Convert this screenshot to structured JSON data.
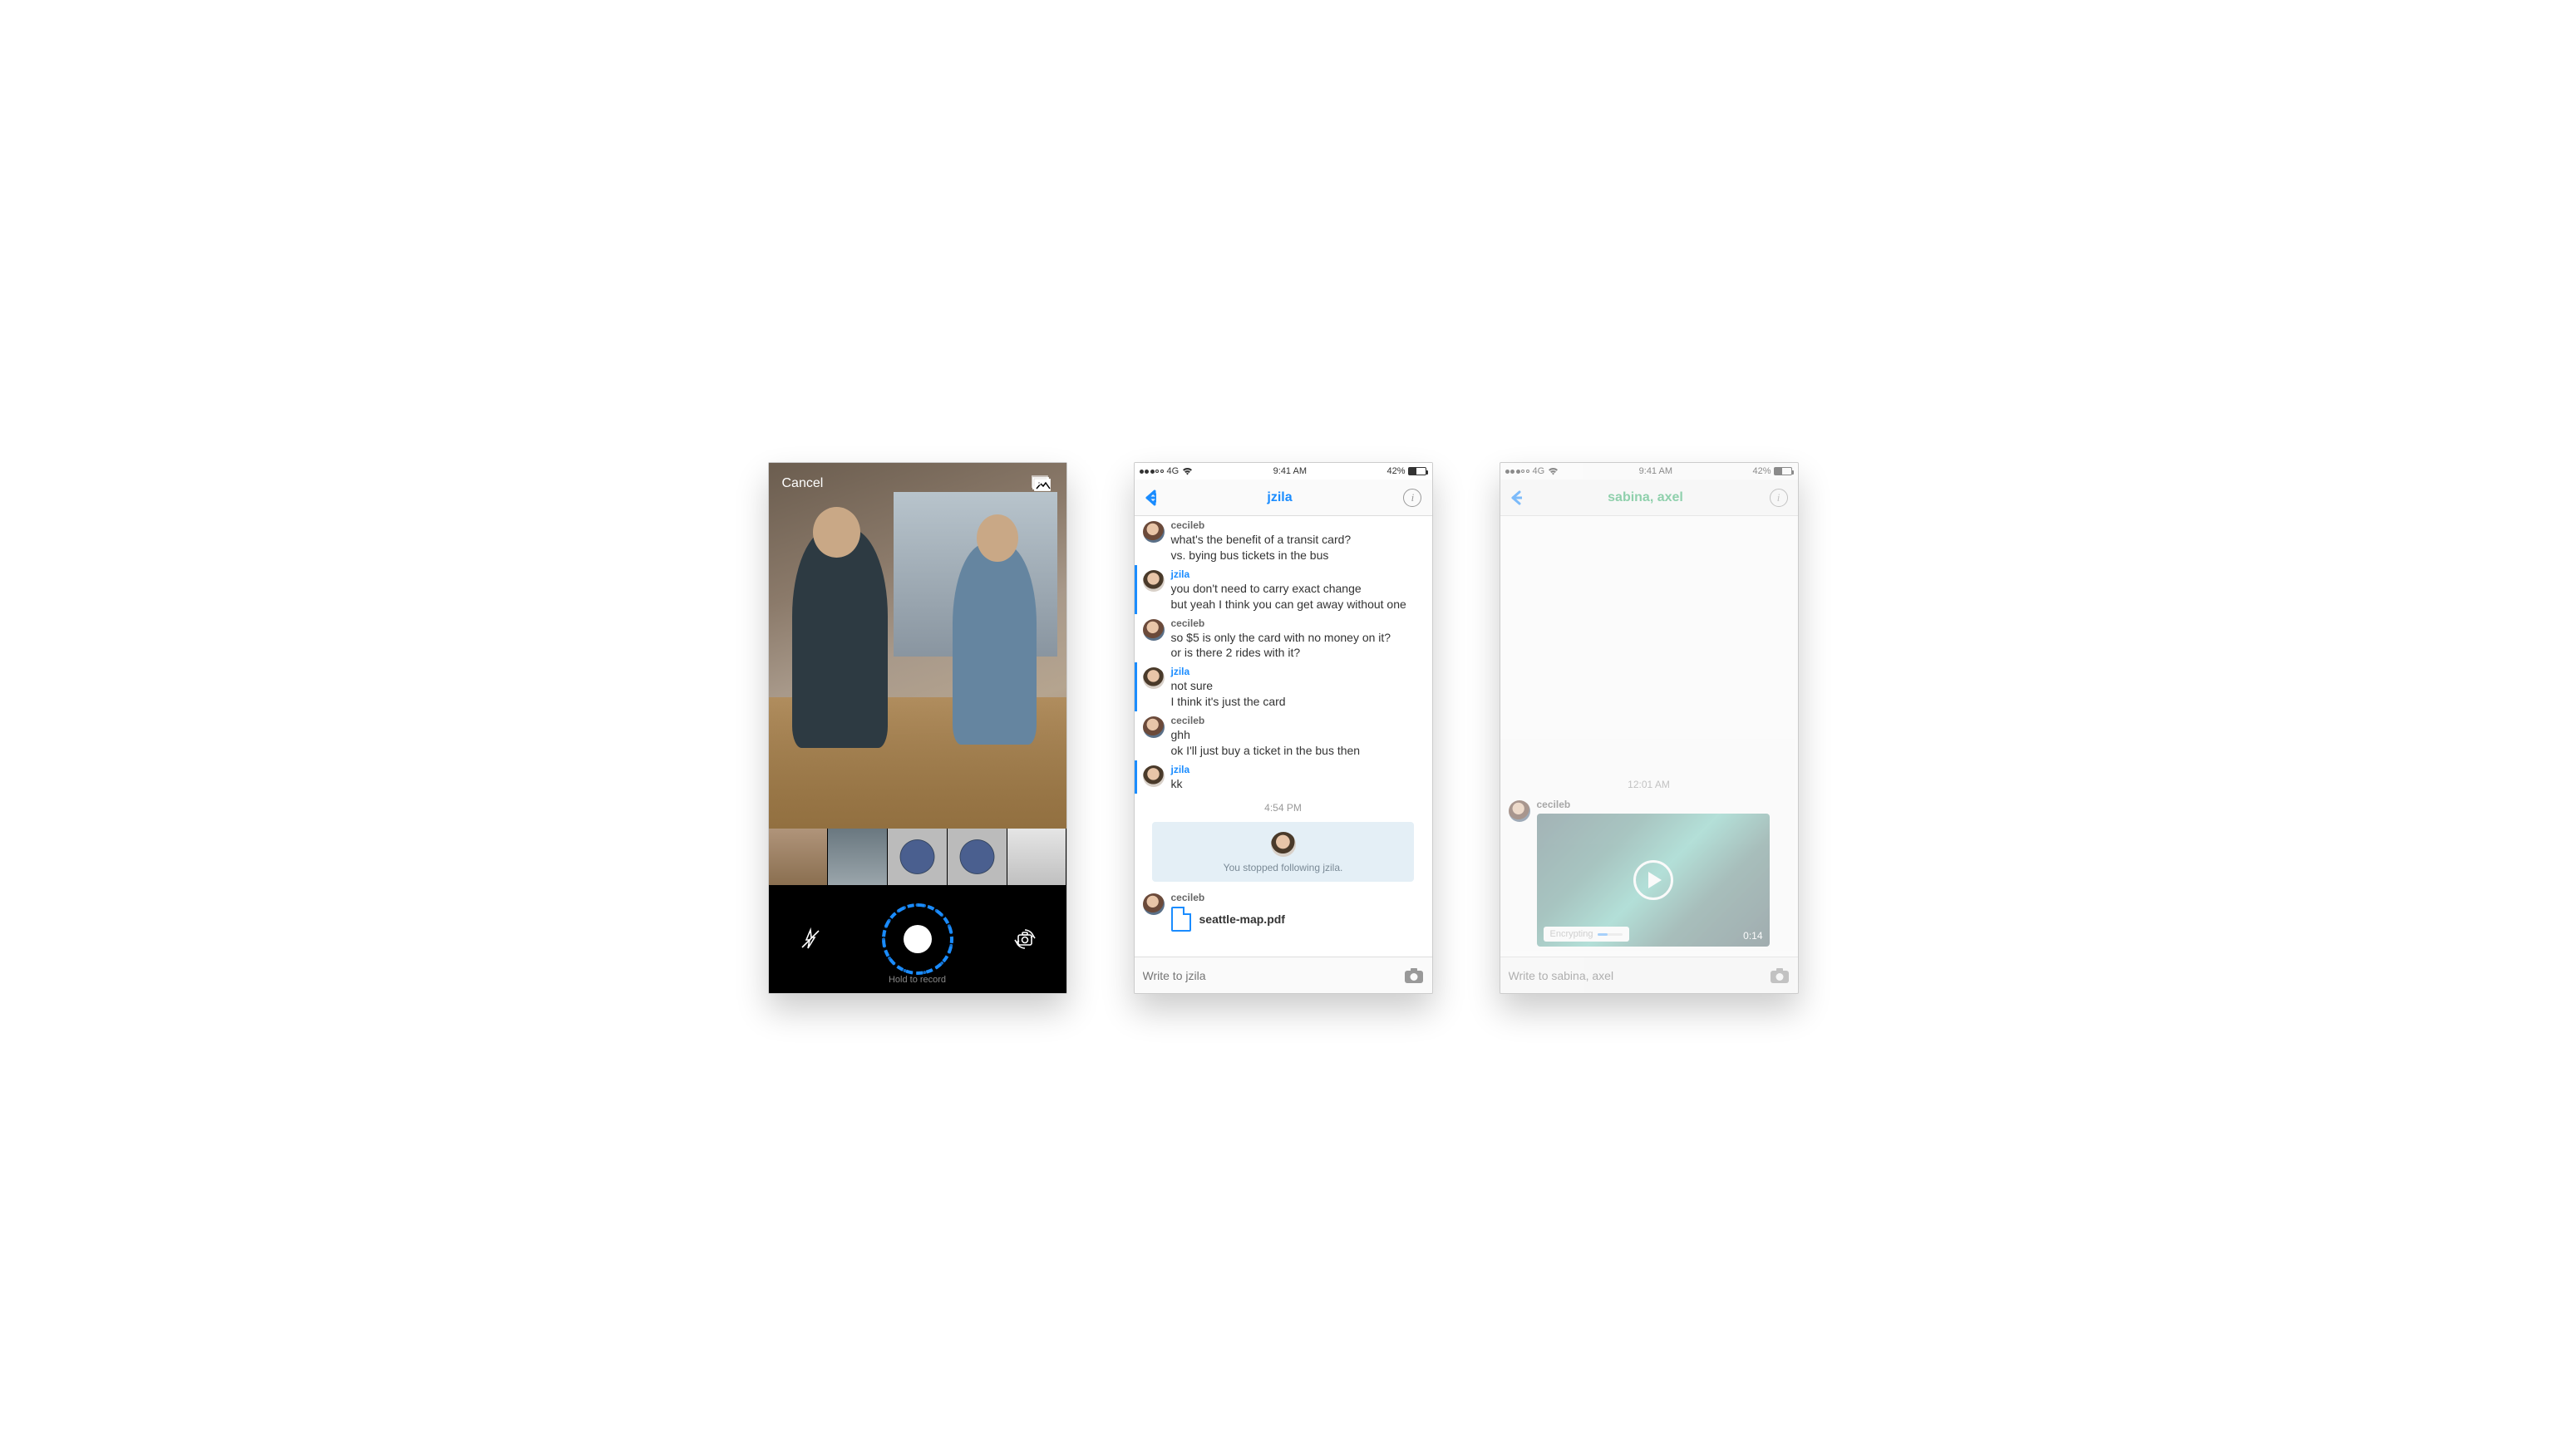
{
  "camera": {
    "cancel": "Cancel",
    "hold_to_record": "Hold to record"
  },
  "status": {
    "carrier": "4G",
    "time": "9:41 AM",
    "battery_pct": "42%"
  },
  "chat1": {
    "title": "jzila",
    "messages": [
      {
        "sender": "cecileb",
        "sender_color": "gray",
        "lines": [
          "what's the benefit of a transit card?",
          "vs. bying bus tickets in the bus"
        ],
        "avatar": "cecile"
      },
      {
        "sender": "jzila",
        "sender_color": "blue",
        "lines": [
          "you don't need to carry exact change",
          "but yeah I think you can get away without one"
        ],
        "avatar": "jzila",
        "stripe": true
      },
      {
        "sender": "cecileb",
        "sender_color": "gray",
        "lines": [
          "so $5 is only the card with no money on it?",
          "or is there 2 rides with it?"
        ],
        "avatar": "cecile"
      },
      {
        "sender": "jzila",
        "sender_color": "blue",
        "lines": [
          "not sure",
          "I think it's just the card"
        ],
        "avatar": "jzila",
        "stripe": true
      },
      {
        "sender": "cecileb",
        "sender_color": "gray",
        "lines": [
          "ghh",
          "ok I'll just buy a ticket in the bus then"
        ],
        "avatar": "cecile"
      },
      {
        "sender": "jzila",
        "sender_color": "blue",
        "lines": [
          "kk"
        ],
        "avatar": "jzila",
        "stripe": true
      }
    ],
    "timestamp": "4:54 PM",
    "system_msg": "You stopped following jzila.",
    "file_msg": {
      "sender": "cecileb",
      "filename": "seattle-map.pdf"
    },
    "placeholder": "Write to jzila"
  },
  "chat2": {
    "title": "sabina, axel",
    "timestamp": "12:01 AM",
    "video_sender": "cecileb",
    "video_duration": "0:14",
    "encrypting": "Encrypting",
    "placeholder": "Write to sabina, axel"
  }
}
